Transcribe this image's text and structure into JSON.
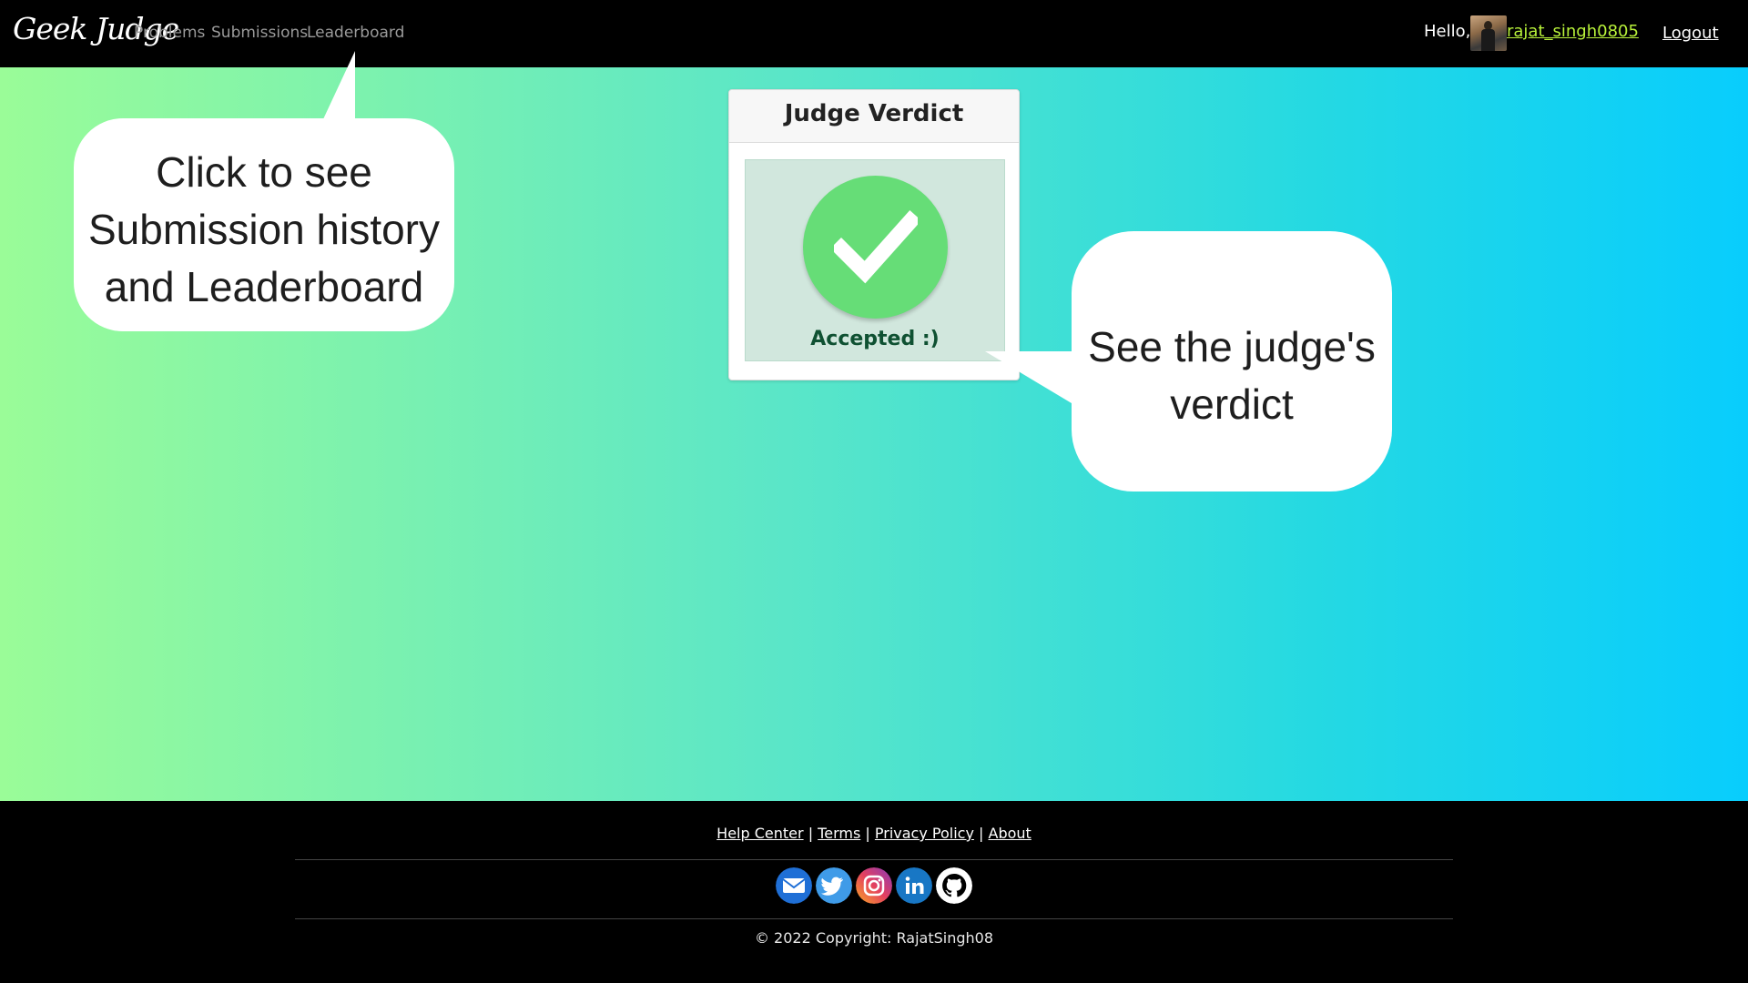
{
  "navbar": {
    "brand": "Geek Judge",
    "links": [
      "Problems",
      "Submissions",
      "Leaderboard"
    ],
    "greeting": "Hello,",
    "username": "rajat_singh0805",
    "logout": "Logout"
  },
  "verdict_card": {
    "title": "Judge Verdict",
    "status": "Accepted :)",
    "icon": "check-circle-icon"
  },
  "callouts": {
    "left_lines": [
      "Click to see",
      "Submission history",
      "and Leaderboard"
    ],
    "right_lines": [
      "See the judge's",
      "verdict"
    ]
  },
  "footer": {
    "links": [
      "Help Center",
      "Terms",
      "Privacy Policy",
      "About"
    ],
    "separator": "|",
    "social_icons": [
      "mail-icon",
      "twitter-icon",
      "instagram-icon",
      "linkedin-icon",
      "github-icon"
    ],
    "copyright": "© 2022 Copyright: RajatSingh08"
  },
  "colors": {
    "gradient_start": "#9afc98",
    "gradient_end": "#08cdfd",
    "username": "#b8f23a",
    "success_bg": "#d1e7dd",
    "success_text": "#0f5132",
    "check_green": "#66dd77"
  }
}
